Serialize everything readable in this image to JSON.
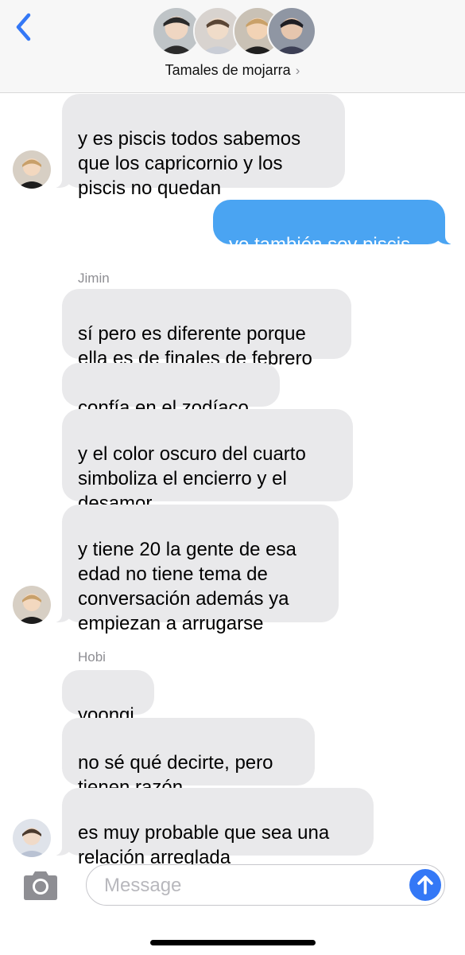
{
  "header": {
    "group_name": "Tamales de mojarra",
    "chevron": "›",
    "avatars": [
      "avatar-1",
      "avatar-2",
      "avatar-3",
      "avatar-4"
    ]
  },
  "messages": [
    {
      "sender": "",
      "text": "y es piscis todos sabemos\nque los capricornio y los\npiscis no quedan",
      "direction": "in"
    },
    {
      "sender": "",
      "text": "yo también soy piscis",
      "direction": "out"
    },
    {
      "sender": "Jimin",
      "text": "sí pero es diferente porque\nella es de finales de febrero",
      "direction": "in"
    },
    {
      "sender": "",
      "text": "confía en el zodíaco",
      "direction": "in"
    },
    {
      "sender": "",
      "text": "y el color oscuro del cuarto\nsimboliza el encierro y el\ndesamor",
      "direction": "in"
    },
    {
      "sender": "",
      "text": "y tiene 20 la gente de esa\nedad no tiene tema de\nconversación además ya\nempiezan a arrugarse",
      "direction": "in"
    },
    {
      "sender": "Hobi",
      "text": "yoongi",
      "direction": "in"
    },
    {
      "sender": "",
      "text": "no sé qué decirte, pero\ntienen razón",
      "direction": "in"
    },
    {
      "sender": "",
      "text": "es muy probable que sea una\nrelación arreglada",
      "direction": "in"
    }
  ],
  "senders": {
    "jimin": "Jimin",
    "hobi": "Hobi"
  },
  "composer": {
    "placeholder": "Message",
    "value": ""
  },
  "colors": {
    "accent": "#3478f6",
    "outgoing_bubble": "#4aa4f2",
    "incoming_bubble": "#e9e9eb",
    "header_bg": "#f7f7f7"
  },
  "icons": {
    "back": "chevron-left-icon",
    "camera": "camera-icon",
    "send": "arrow-up-icon"
  }
}
